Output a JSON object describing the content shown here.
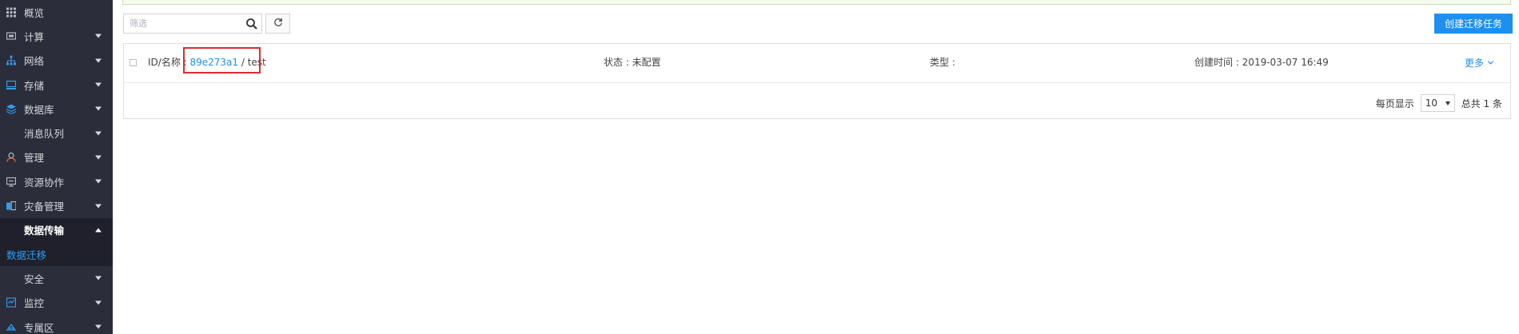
{
  "sidebar": {
    "items": [
      {
        "label": "概览",
        "icon": "grid-icon",
        "caret": ""
      },
      {
        "label": "计算",
        "icon": "compute-icon",
        "caret": "down"
      },
      {
        "label": "网络",
        "icon": "network-icon",
        "caret": "down"
      },
      {
        "label": "存储",
        "icon": "storage-icon",
        "caret": "down"
      },
      {
        "label": "数据库",
        "icon": "database-icon",
        "caret": "down"
      },
      {
        "label": "消息队列",
        "icon": "",
        "caret": "down"
      },
      {
        "label": "管理",
        "icon": "user-manage-icon",
        "caret": "down"
      },
      {
        "label": "资源协作",
        "icon": "collab-icon",
        "caret": "down"
      },
      {
        "label": "灾备管理",
        "icon": "backup-icon",
        "caret": "down"
      },
      {
        "label": "数据传输",
        "icon": "",
        "caret": "up"
      },
      {
        "label": "数据迁移",
        "icon": "",
        "caret": ""
      },
      {
        "label": "安全",
        "icon": "",
        "caret": "down"
      },
      {
        "label": "监控",
        "icon": "monitor-icon",
        "caret": "down"
      },
      {
        "label": "专属区",
        "icon": "cloud-icon",
        "caret": "down"
      }
    ]
  },
  "toolbar": {
    "filter_placeholder": "筛选",
    "create_label": "创建迁移任务"
  },
  "task": {
    "id_label": "ID/名称 : ",
    "id": "89e273a1",
    "name_sep": " / test",
    "status": "状态 : 未配置",
    "type": "类型 :",
    "created": "创建时间 : 2019-03-07 16:49",
    "more": "更多"
  },
  "pagination": {
    "per_page_label": "每页显示",
    "per_page_value": "10",
    "total": "总共 1 条"
  },
  "colors": {
    "accent": "#1e8fef",
    "sidebar_bg": "#2b2d3a",
    "highlight": "#e02b2b"
  }
}
